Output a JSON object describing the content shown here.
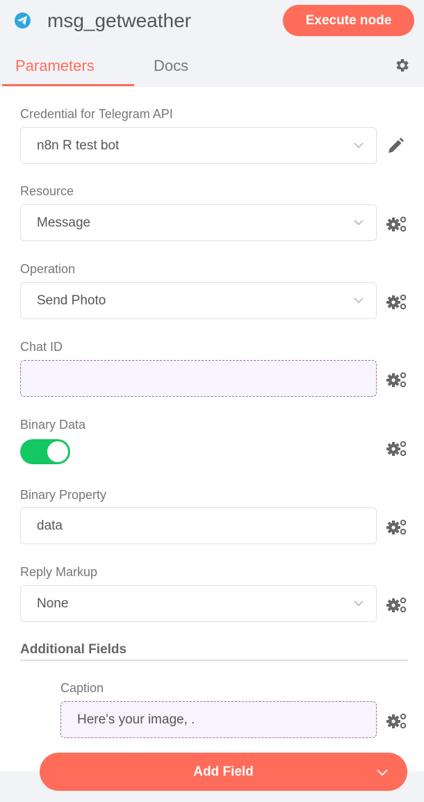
{
  "header": {
    "node_icon": "telegram-icon",
    "node_title": "msg_getweather",
    "execute_label": "Execute node",
    "accent_color": "#ff6d5a"
  },
  "tabs": [
    {
      "label": "Parameters",
      "active": true
    },
    {
      "label": "Docs",
      "active": false
    }
  ],
  "settings_icon": "gear-icon",
  "fields": {
    "credential": {
      "label": "Credential for Telegram API",
      "value": "n8n R test bot",
      "type": "select",
      "action_icon": "pencil-icon"
    },
    "resource": {
      "label": "Resource",
      "value": "Message",
      "type": "select",
      "action_icon": "parameter-options-icon"
    },
    "operation": {
      "label": "Operation",
      "value": "Send Photo",
      "type": "select",
      "action_icon": "parameter-options-icon"
    },
    "chat_id": {
      "label": "Chat ID",
      "value": "",
      "type": "expression",
      "action_icon": "parameter-options-icon"
    },
    "binary_data": {
      "label": "Binary Data",
      "value": true,
      "type": "toggle",
      "action_icon": "parameter-options-icon"
    },
    "binary_property": {
      "label": "Binary Property",
      "value": "data",
      "type": "text",
      "action_icon": "parameter-options-icon"
    },
    "reply_markup": {
      "label": "Reply Markup",
      "value": "None",
      "type": "select",
      "action_icon": "parameter-options-icon"
    }
  },
  "additional_fields": {
    "title": "Additional Fields",
    "caption": {
      "label": "Caption",
      "value": "Here's your image, .",
      "type": "expression",
      "action_icon": "parameter-options-icon"
    },
    "add_field_label": "Add Field"
  }
}
